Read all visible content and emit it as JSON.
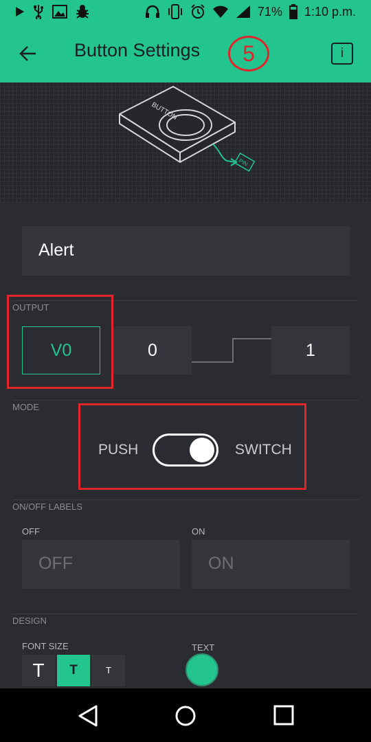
{
  "status_bar": {
    "battery": "71%",
    "time": "1:10 p.m.",
    "left_icons": [
      "play-icon",
      "usb-icon",
      "image-icon",
      "bug-icon"
    ],
    "right_icons": [
      "headphones-icon",
      "vibrate-icon",
      "alarm-icon",
      "wifi-icon",
      "signal-icon",
      "battery-icon"
    ]
  },
  "header": {
    "title": "Button Settings",
    "step_annotation": "5",
    "info_label": "i"
  },
  "illustration": {
    "widget_label": "BUTTON",
    "pin_label": "PIN"
  },
  "widget": {
    "name": "Alert"
  },
  "output": {
    "section_label": "OUTPUT",
    "pin": "V0",
    "min_value": "0",
    "max_value": "1"
  },
  "mode": {
    "section_label": "MODE",
    "push_label": "PUSH",
    "switch_label": "SWITCH",
    "selected": "SWITCH"
  },
  "labels": {
    "section_label": "ON/OFF LABELS",
    "off_label": "OFF",
    "on_label": "ON",
    "off_placeholder": "OFF",
    "on_placeholder": "ON"
  },
  "design": {
    "section_label": "DESIGN",
    "font_size_label": "FONT SIZE",
    "text_label": "TEXT",
    "font_sizes": [
      "T",
      "T",
      "T"
    ],
    "selected_font_size": 1,
    "text_color": "#23c48e"
  },
  "colors": {
    "accent": "#23c48e",
    "annotation": "#e0262b"
  }
}
